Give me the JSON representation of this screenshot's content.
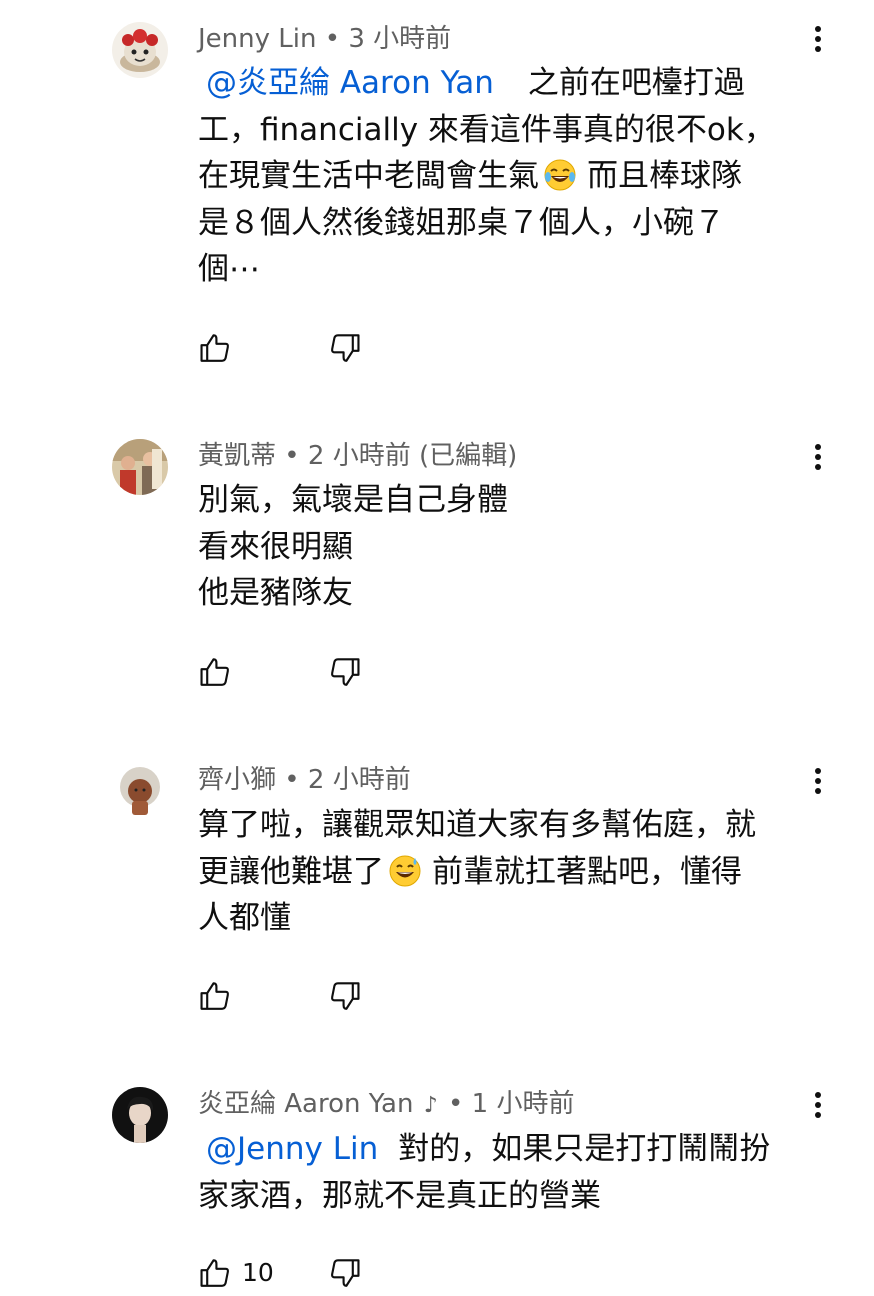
{
  "comments": [
    {
      "author": "Jenny Lin",
      "time": "• 3 小時前",
      "avatar_icon": "cake-avatar",
      "mention": "@炎亞綸 Aaron Yan",
      "lines": [
        "之前在吧檯打過",
        "工，financially 來看這件事真的很不ok，",
        "在現實生活中老闆會生氣",
        "而且棒球隊",
        "是８個人然後錢姐那桌７個人，小碗７",
        "個⋯"
      ],
      "emoji": "tears-of-joy-emoji"
    },
    {
      "author": "黃凱蒂",
      "time": "• 2 小時前 (已編輯)",
      "avatar_icon": "group-photo-avatar",
      "lines": [
        "別氣，氣壞是自己身體",
        "看來很明顯",
        "他是豬隊友"
      ]
    },
    {
      "author": "齊小獅",
      "time": "• 2 小時前",
      "avatar_icon": "lion-avatar",
      "lines": [
        "算了啦，讓觀眾知道大家有多幫佑庭，就",
        "更讓他難堪了",
        "前輩就扛著點吧，懂得",
        "人都懂"
      ],
      "emoji": "grinning-sweat-emoji"
    },
    {
      "author": "炎亞綸 Aaron Yan",
      "time": "• 1 小時前",
      "verified_icon": "music-note-icon",
      "avatar_icon": "portrait-avatar",
      "mention": "@Jenny Lin",
      "lines": [
        "對的，如果只是打打鬧鬧扮",
        "家家酒，那就不是真正的營業"
      ],
      "likes": "10"
    }
  ],
  "colors": {
    "meta": "#606060",
    "mention": "#065fd4",
    "text": "#0f0f0f"
  }
}
